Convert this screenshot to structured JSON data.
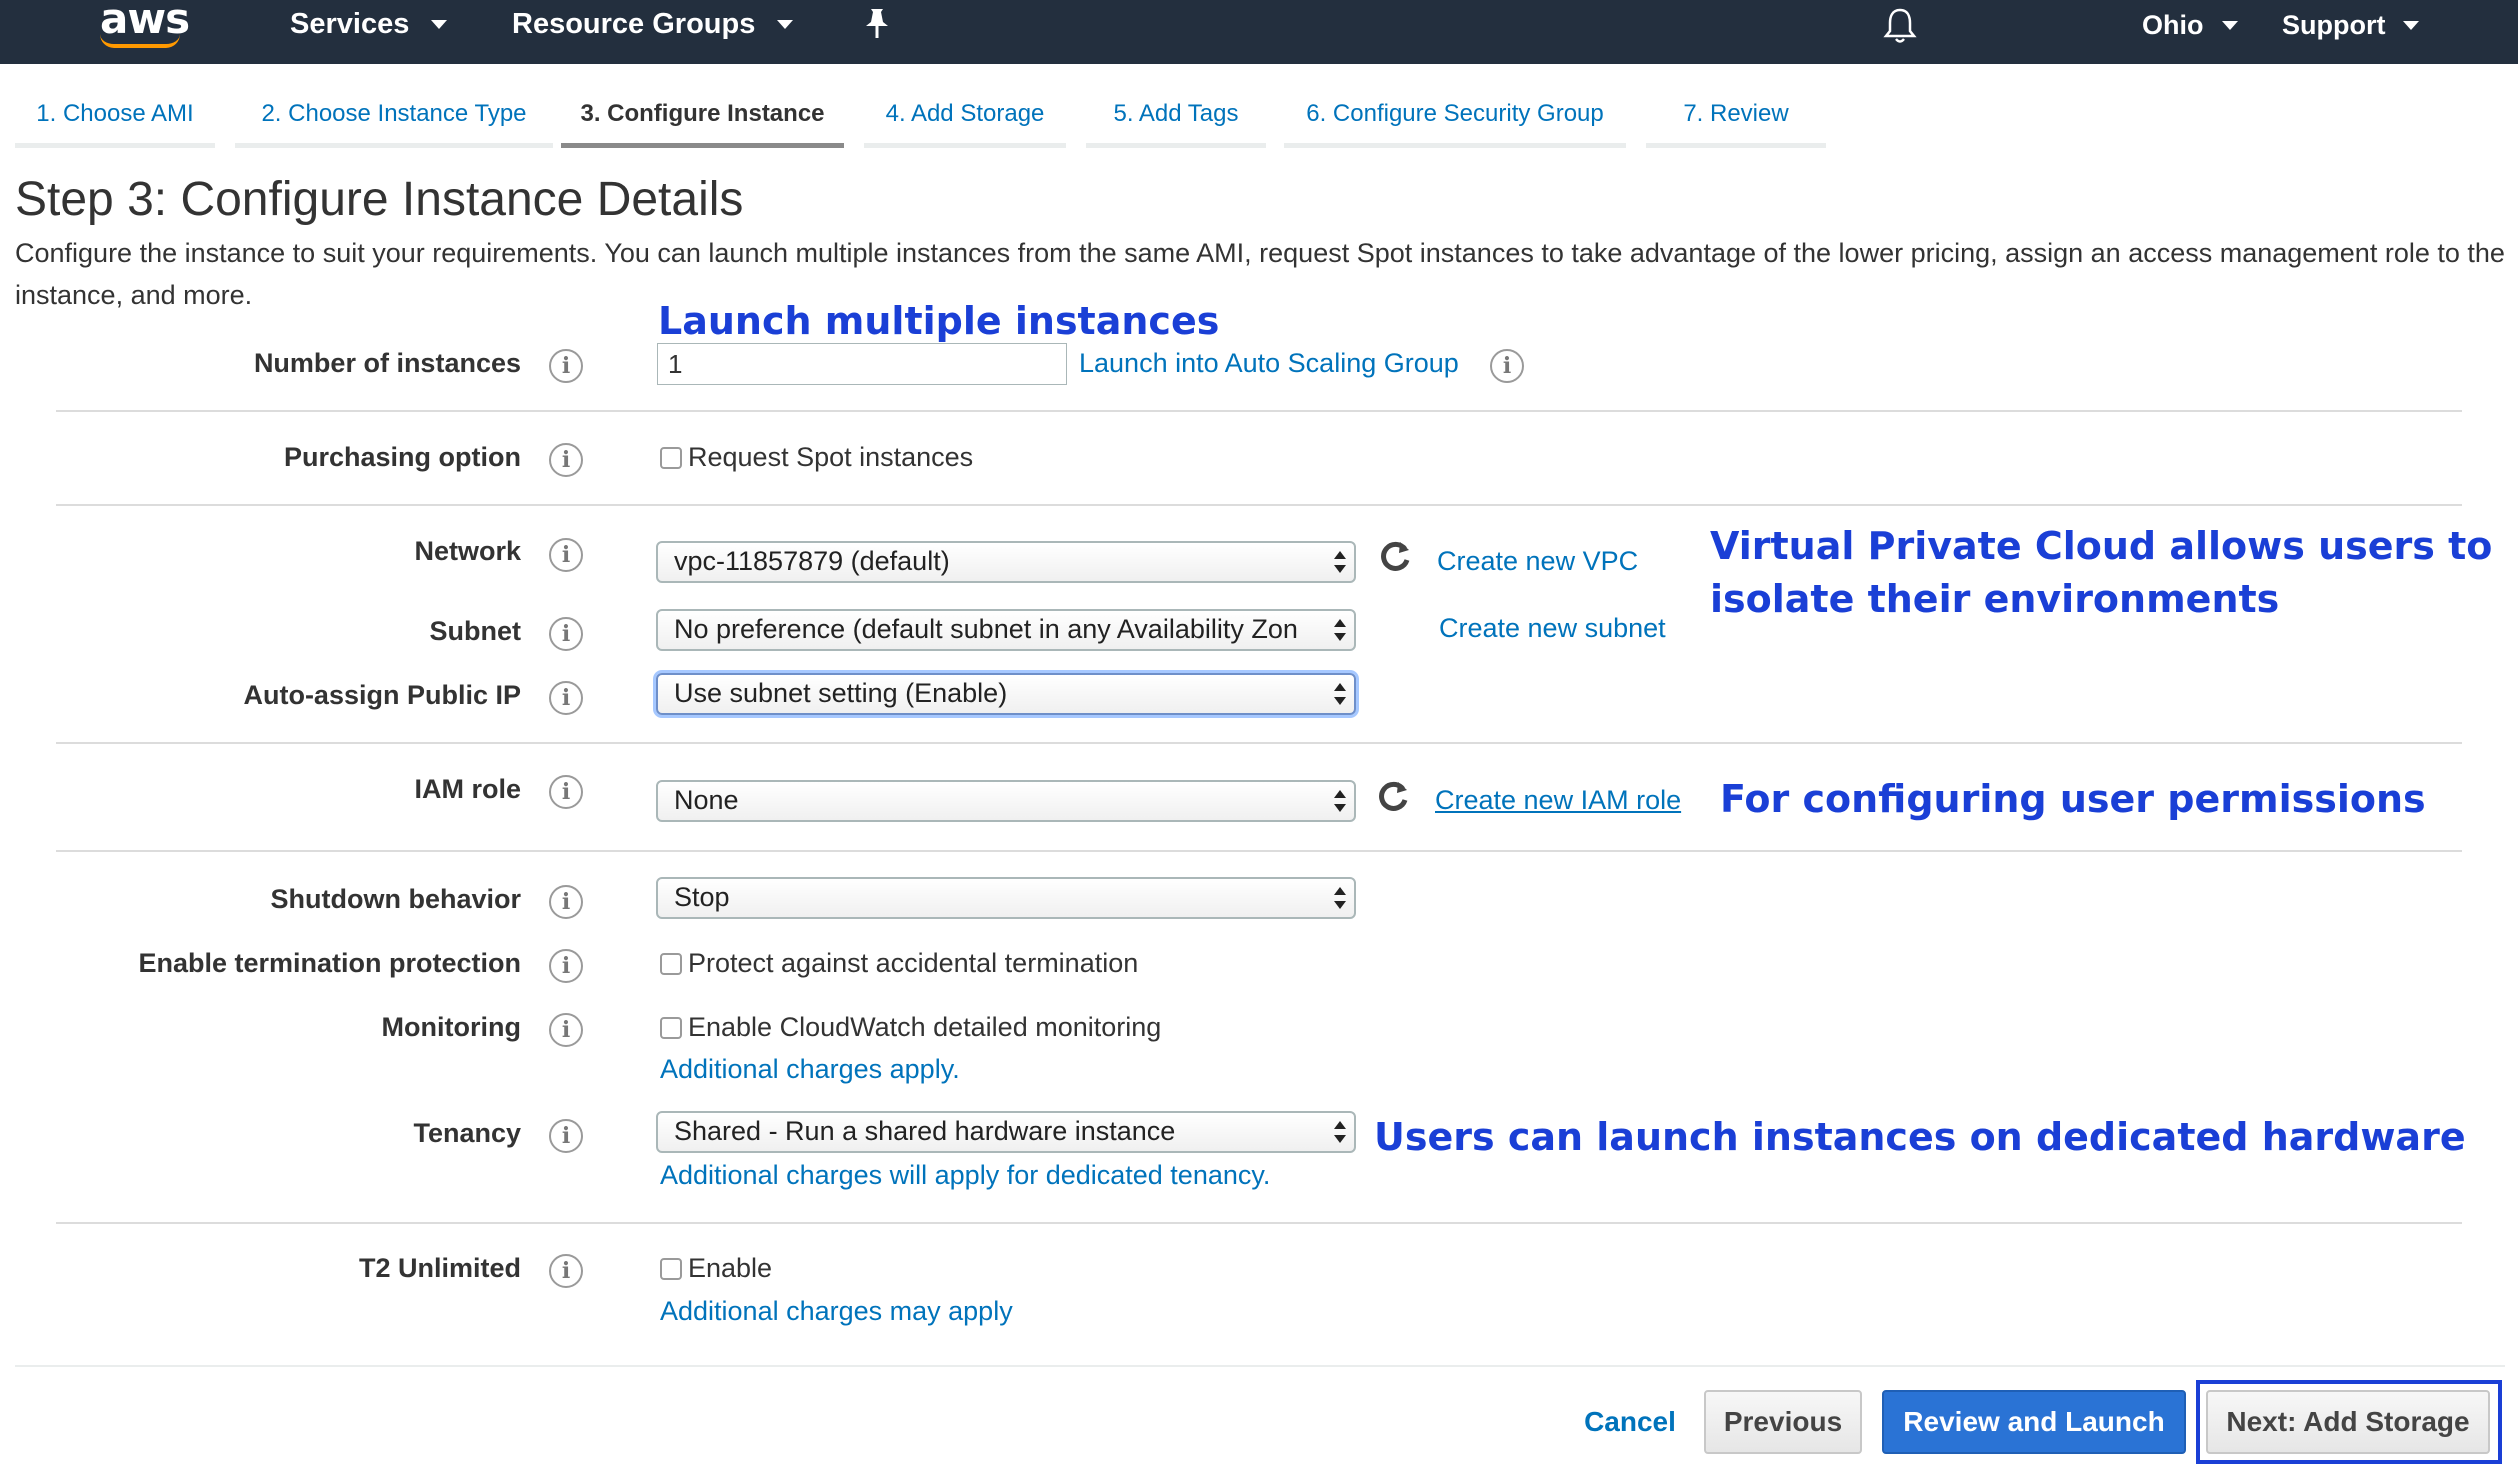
{
  "topnav": {
    "logo": "aws",
    "services_label": "Services",
    "resource_groups_label": "Resource Groups",
    "pin_icon": "pin-icon",
    "bell_icon": "bell-icon",
    "region_label": "Ohio",
    "support_label": "Support"
  },
  "wizard_tabs": [
    {
      "label": "1. Choose AMI"
    },
    {
      "label": "2. Choose Instance Type"
    },
    {
      "label": "3. Configure Instance"
    },
    {
      "label": "4. Add Storage"
    },
    {
      "label": "5. Add Tags"
    },
    {
      "label": "6. Configure Security Group"
    },
    {
      "label": "7. Review"
    }
  ],
  "page": {
    "title": "Step 3: Configure Instance Details",
    "description": "Configure the instance to suit your requirements. You can launch multiple instances from the same AMI, request Spot instances to take advantage of the lower pricing, assign an access management role to the instance, and more."
  },
  "annotations": {
    "launch_multiple": "Launch multiple instances",
    "vpc_line1": "Virtual Private Cloud allows users to",
    "vpc_line2": "isolate their environments",
    "iam": "For configuring user permissions",
    "tenancy": "Users can launch instances on dedicated hardware"
  },
  "form": {
    "number_of_instances": {
      "label": "Number of instances",
      "value": "1",
      "link": "Launch into Auto Scaling Group"
    },
    "purchasing_option": {
      "label": "Purchasing option",
      "checkbox_label": "Request Spot instances"
    },
    "network": {
      "label": "Network",
      "value": "vpc-11857879 (default)",
      "link": "Create new VPC"
    },
    "subnet": {
      "label": "Subnet",
      "value": "No preference (default subnet in any Availability Zon",
      "link": "Create new subnet"
    },
    "auto_assign_ip": {
      "label": "Auto-assign Public IP",
      "value": "Use subnet setting (Enable)"
    },
    "iam_role": {
      "label": "IAM role",
      "value": "None",
      "link": "Create new IAM role"
    },
    "shutdown_behavior": {
      "label": "Shutdown behavior",
      "value": "Stop"
    },
    "termination_protection": {
      "label": "Enable termination protection",
      "checkbox_label": "Protect against accidental termination"
    },
    "monitoring": {
      "label": "Monitoring",
      "checkbox_label": "Enable CloudWatch detailed monitoring",
      "note": "Additional charges apply."
    },
    "tenancy": {
      "label": "Tenancy",
      "value": "Shared - Run a shared hardware instance",
      "note": "Additional charges will apply for dedicated tenancy."
    },
    "t2_unlimited": {
      "label": "T2 Unlimited",
      "checkbox_label": "Enable",
      "note": "Additional charges may apply"
    }
  },
  "footer": {
    "cancel": "Cancel",
    "previous": "Previous",
    "review_and_launch": "Review and Launch",
    "next": "Next: Add Storage"
  },
  "colors": {
    "nav_bg": "#232f3e",
    "link": "#0073bb",
    "annotation": "#1a3fd6",
    "primary_button": "#2a73d5"
  }
}
